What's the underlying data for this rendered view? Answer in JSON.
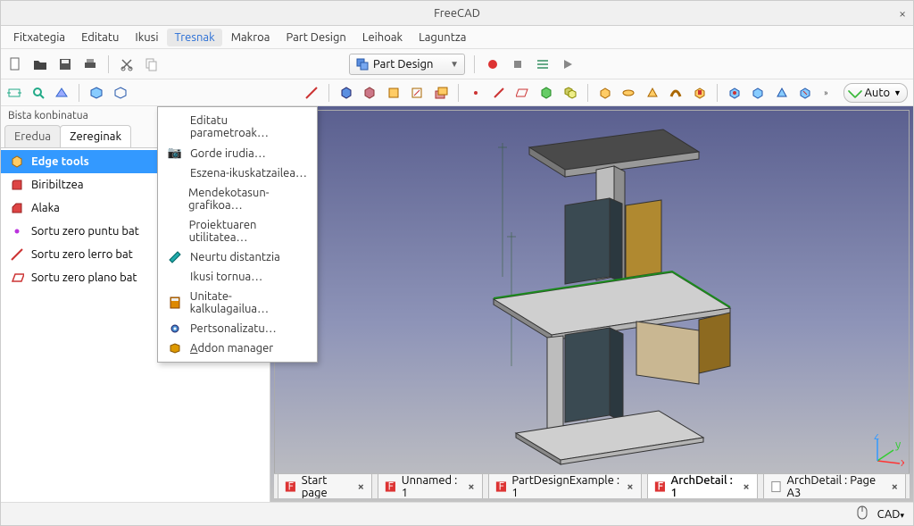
{
  "app": {
    "title": "FreeCAD"
  },
  "menus": {
    "file": "Fitxategia",
    "edit": "Editatu",
    "view": "Ikusi",
    "tools": "Tresnak",
    "macro": "Makroa",
    "partdesign": "Part Design",
    "windows": "Leihoak",
    "help": "Laguntza"
  },
  "tools_menu": {
    "edit_params": "Editatu parametroak…",
    "save_image": "Gorde irudia…",
    "scene_inspector": "Eszena-ikuskatzailea…",
    "dep_graph": "Mendekotasun-grafikoa…",
    "proj_util": "Proiektuaren utilitatea…",
    "measure_dist": "Neurtu distantzia",
    "view_turntable": "Ikusi tornua…",
    "units_calc": "Unitate-kalkulagailua…",
    "customize": "Pertsonalizatu…",
    "addon_mgr": "Addon manager"
  },
  "workbench": {
    "label": "Part Design"
  },
  "autobtn": {
    "label": "Auto"
  },
  "leftpanel": {
    "title": "Bista konbinatua",
    "tab_model": "Eredua",
    "tab_tasks": "Zereginak",
    "items": [
      {
        "label": "Edge tools"
      },
      {
        "label": "Biribiltzea"
      },
      {
        "label": "Alaka"
      },
      {
        "label": "Sortu zero puntu bat"
      },
      {
        "label": "Sortu zero lerro bat"
      },
      {
        "label": "Sortu zero plano bat"
      }
    ]
  },
  "docs": [
    {
      "label": "Start page"
    },
    {
      "label": "Unnamed : 1"
    },
    {
      "label": "PartDesignExample : 1"
    },
    {
      "label": "ArchDetail : 1",
      "active": true
    },
    {
      "label": "ArchDetail : Page A3"
    }
  ],
  "status": {
    "nav": "CAD"
  },
  "axes": {
    "x": "x",
    "y": "y",
    "z": "z"
  }
}
